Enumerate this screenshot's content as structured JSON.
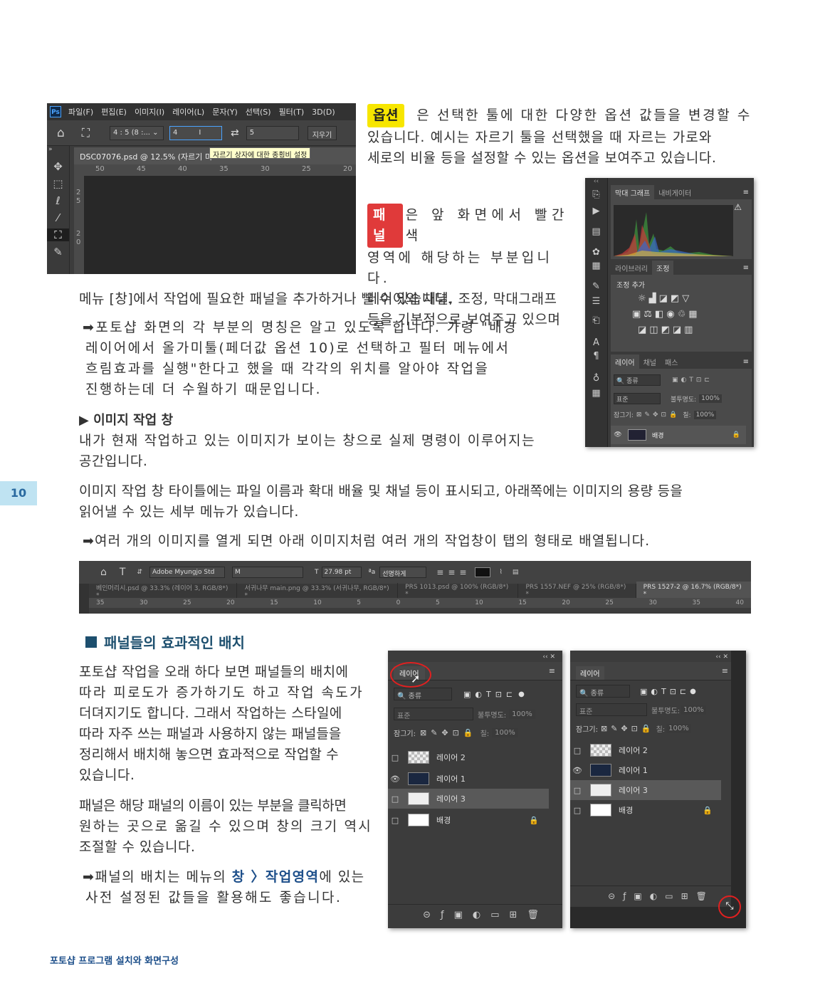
{
  "options_shot": {
    "menu": [
      "파일(F)",
      "편집(E)",
      "이미지(I)",
      "레이어(L)",
      "문자(Y)",
      "선택(S)",
      "필터(T)",
      "3D(D)"
    ],
    "ratio_select": "4 : 5 (8 :...",
    "width_value": "4",
    "height_value": "5",
    "clear_button": "지우기",
    "doc_tab": "DSC07076.psd @ 12.5% (자르기 미",
    "tooltip": "자르기 상자에 대한 종횡비 설정",
    "ruler_labels": [
      "50",
      "45",
      "40",
      "35",
      "30",
      "25",
      "20"
    ],
    "vruler_labels": [
      "2",
      "5",
      "2",
      "0"
    ]
  },
  "paragraph_options": {
    "tag": "옵션",
    "line1": "은 선택한 툴에 대한 다양한 옵션 값들을 변경할 수",
    "line2": "있습니다. 예시는 자르기 툴을 선택했을 때 자르는 가로와",
    "line3": "세로의 비율 등을 설정할 수 있는 옵션을 보여주고 있습니다."
  },
  "paragraph_panel": {
    "tag": "패널",
    "line1": "은 앞 화면에서 빨간색",
    "line2": "영역에 해당하는 부분입니다.",
    "line3": "레이어와 채널, 조정, 막대그래프",
    "line4": "등을 기본적으로 보여주고 있으며",
    "line5": "메뉴 [창]에서 작업에 필요한 패널을 추가하거나 뺄 수 있습니다."
  },
  "panel_shot": {
    "tab_histogram": "막대 그래프",
    "tab_navigator": "내비게이터",
    "tab_library": "라이브러리",
    "tab_adjust": "조정",
    "adjust_add": "조정 추가",
    "tab_layers": "레이어",
    "tab_channels": "채널",
    "tab_paths": "패스",
    "search": "종류",
    "blend": "표준",
    "opacity_label": "불투명도:",
    "opacity_value": "100%",
    "lock_label": "잠그기:",
    "fill_label": "칠:",
    "fill_value": "100%",
    "layer_name": "배경"
  },
  "note1": {
    "line1": "➡포토샵 화면의 각 부분의 명칭은 알고 있도록 합니다. 가령 \"배경",
    "line2": "레이어에서 올가미툴(페더값 옵션 10)로 선택하고 필터 메뉴에서",
    "line3": "흐림효과를 실행\"한다고 했을 때 각각의 위치를 알아야 작업을",
    "line4": "진행하는데 더 수월하기 때문입니다."
  },
  "section_image_window": {
    "heading": "▶ 이미지 작업 창",
    "line1": "내가 현재 작업하고 있는 이미지가 보이는 창으로 실제 명령이 이루어지는",
    "line2": "공간입니다.",
    "line3": "이미지 작업 창 타이틀에는 파일 이름과 확대 배율 및 채널 등이 표시되고, 아래쪽에는 이미지의 용량 등을",
    "line4": "읽어낼 수 있는 세부 메뉴가 있습니다.",
    "note": "➡여러 개의 이미지를 열게 되면 아래 이미지처럼 여러 개의 작업창이 탭의 형태로 배열됩니다."
  },
  "page_number": "10",
  "tabs_shot": {
    "font": "Adobe Myungjo Std",
    "style": "M",
    "size": "27.98 pt",
    "aa": "선명하게",
    "tabs": [
      "베인머리시.psd @ 33.3% (레이어 3, RGB/8*) *",
      "서귀나무 main.png @ 33.3% (서귀나무, RGB/8*) *",
      "PRS 1013.psd @ 100% (RGB/8*) *",
      "PRS 1557.NEF @ 25% (RGB/8*) *",
      "PRS 1527-2 @ 16.7% (RGB/8*) *"
    ],
    "ruler": [
      "35",
      "30",
      "25",
      "20",
      "15",
      "10",
      "5",
      "0",
      "5",
      "10",
      "15",
      "20",
      "25",
      "30",
      "35",
      "40"
    ]
  },
  "section_panels": {
    "heading": "패널들의 효과적인 배치",
    "p1": [
      "포토샵 작업을 오래 하다 보면 패널들의 배치에",
      "따라 피로도가 증가하기도 하고 작업 속도가",
      "더뎌지기도 합니다. 그래서 작업하는 스타일에",
      "따라 자주 쓰는 패널과 사용하지 않는 패널들을",
      "정리해서 배치해 놓으면 효과적으로 작업할 수",
      "있습니다."
    ],
    "p2": [
      "패널은 해당 패널의 이름이 있는 부분을 클릭하면",
      "원하는 곳으로 옮길 수 있으며 창의 크기 역시",
      "조절할 수 있습니다."
    ],
    "note_pre": "➡패널의 배치는 메뉴의 ",
    "note_highlight": "창 〉작업영역",
    "note_post": "에 있는",
    "note_line2": "사전 설정된 값들을 활용해도 좋습니다."
  },
  "layers_panel": {
    "title": "레이어",
    "search": "종류",
    "blend": "표준",
    "opacity_label": "불투명도:",
    "opacity_value": "100%",
    "lock_label": "잠그기:",
    "fill_label": "칠:",
    "fill_value": "100%",
    "layers": [
      "레이어 2",
      "레이어 1",
      "레이어 3",
      "배경"
    ]
  },
  "footer": "포토샵 프로그램 설치와 화면구성"
}
